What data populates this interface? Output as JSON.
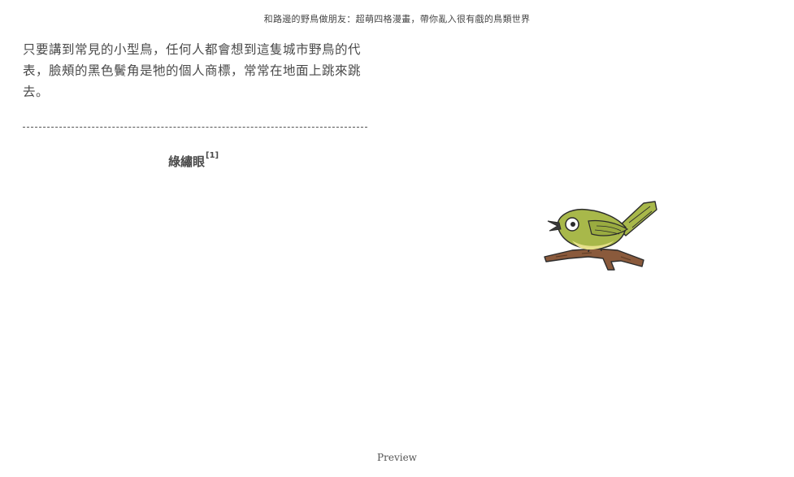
{
  "header": {
    "running_title": "和路邊的野鳥做朋友：超萌四格漫畫，帶你亂入很有戲的鳥類世界"
  },
  "content": {
    "paragraph": "只要講到常見的小型鳥，任何人都會想到這隻城市野鳥的代表，臉頰的黑色鬢角是牠的個人商標，常常在地面上跳來跳去。",
    "caption": "綠繡眼",
    "footnote_ref": "[1]"
  },
  "illustration": {
    "subject": "bird-on-branch-icon",
    "colors": {
      "body": "#a8b84a",
      "belly": "#e6e08a",
      "branch": "#8a5a3c",
      "outline": "#2b2b2b"
    }
  },
  "footer": {
    "label": "Preview"
  }
}
